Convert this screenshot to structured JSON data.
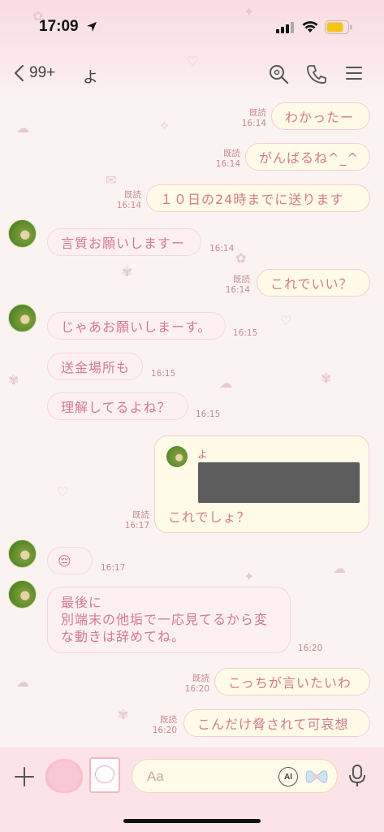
{
  "status_bar": {
    "time": "17:09"
  },
  "header": {
    "back_count": "99+",
    "chat_name": "よ"
  },
  "messages": [
    {
      "dir": "out",
      "text": "わかったー",
      "read": "既読",
      "time": "16:14"
    },
    {
      "dir": "out",
      "text": "がんばるね^_^",
      "read": "既読",
      "time": "16:14"
    },
    {
      "dir": "out",
      "text": "１０日の24時までに送ります",
      "read": "既読",
      "time": "16:14"
    },
    {
      "dir": "in",
      "text": "言質お願いしますー",
      "time": "16:14"
    },
    {
      "dir": "out",
      "text": "これでいい？",
      "read": "既読",
      "time": "16:14"
    },
    {
      "dir": "in",
      "text": "じゃあお願いしまーす。",
      "time": "16:15"
    },
    {
      "dir": "in",
      "text": "送金場所も",
      "time": "16:15"
    },
    {
      "dir": "in",
      "text": "理解してるよね？",
      "time": "16:15"
    },
    {
      "dir": "out",
      "reply_to": "よ",
      "text": "これでしょ？",
      "read": "既読",
      "time": "16:17"
    },
    {
      "dir": "in",
      "text": "😔",
      "time": "16:17"
    },
    {
      "dir": "in",
      "lines": [
        "最後に",
        "別端末の他垢で一応見てるから変",
        "な動きは辞めてね。"
      ],
      "time": "16:20"
    },
    {
      "dir": "out",
      "text": "こっちが言いたいわ",
      "read": "既読",
      "time": "16:20"
    },
    {
      "dir": "out",
      "text": "こんだけ脅されて可哀想",
      "read": "既読",
      "time": "16:20"
    }
  ],
  "input": {
    "placeholder": "Aa",
    "ai_label": "AI"
  },
  "icons": {
    "back": "chevron-left-icon",
    "search": "search-icon",
    "call": "phone-icon",
    "menu": "menu-icon",
    "plus": "plus-icon",
    "mic": "microphone-icon"
  },
  "colors": {
    "bubble_text": "#d47a8e",
    "bubble_out": "#fffbe6",
    "bubble_in": "#fdf0f2",
    "background": "#fbf3f2"
  }
}
